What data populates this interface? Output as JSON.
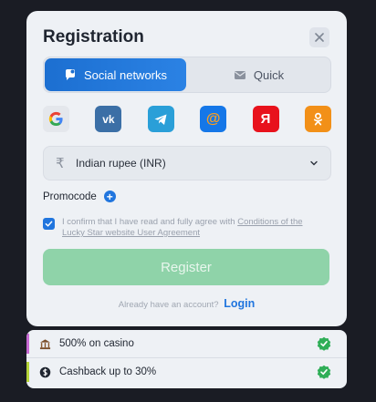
{
  "modal": {
    "title": "Registration",
    "tabs": [
      {
        "label": "Social networks",
        "icon": "chat-bubble-icon",
        "active": true
      },
      {
        "label": "Quick",
        "icon": "envelope-icon",
        "active": false
      }
    ],
    "socials": [
      {
        "name": "google",
        "glyph": "G"
      },
      {
        "name": "vk",
        "glyph": "vk"
      },
      {
        "name": "telegram",
        "glyph": "telegram-plane"
      },
      {
        "name": "mail",
        "glyph": "@"
      },
      {
        "name": "yandex",
        "glyph": "Я"
      },
      {
        "name": "odnoklassniki",
        "glyph": "ok"
      }
    ],
    "currency": {
      "symbol": "₹",
      "value": "Indian rupee (INR)"
    },
    "promocode_label": "Promocode",
    "agree": {
      "text": "I confirm that I have read and fully agree with ",
      "link": "Conditions of the Lucky Star website User Agreement",
      "checked": true
    },
    "register_label": "Register",
    "login_prompt": "Already have an account?",
    "login_label": "Login"
  },
  "bonuses": [
    {
      "label": "500% on casino",
      "icon": "casino-icon",
      "bar_color": "#c86ad4"
    },
    {
      "label": "Cashback up to 30%",
      "icon": "cashback-icon",
      "bar_color": "#b6d43a"
    }
  ],
  "colors": {
    "accent": "#2075de",
    "register": "#8fd3a9",
    "check": "#2fae57"
  }
}
